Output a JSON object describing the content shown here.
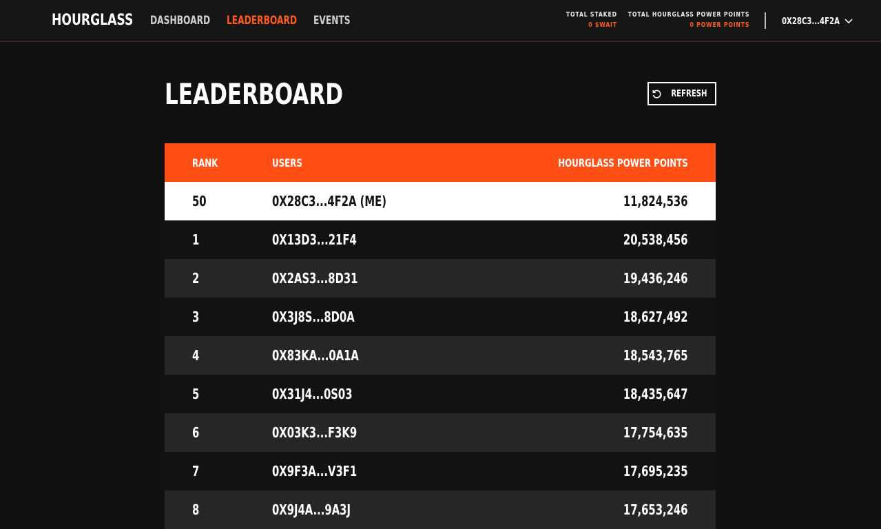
{
  "nav": {
    "brand": "HOURGLASS",
    "links": [
      {
        "label": "DASHBOARD",
        "active": false
      },
      {
        "label": "LEADERBOARD",
        "active": true
      },
      {
        "label": "EVENTS",
        "active": false
      }
    ],
    "stats": {
      "staked_label": "TOTAL STAKED",
      "staked_value": "0 $WAIT",
      "power_label": "TOTAL HOURGLASS POWER POINTS",
      "power_value": "0 POWER POINTS"
    },
    "wallet": "0X28C3...4F2A",
    "accent_color": "#ff5a1f"
  },
  "page": {
    "title": "LEADERBOARD",
    "refresh_label": "REFRESH"
  },
  "table": {
    "headers": {
      "rank": "RANK",
      "users": "USERS",
      "points": "HOURGLASS POWER POINTS"
    },
    "header_color": "#ff4f14",
    "me_row": {
      "rank": "50",
      "user": "0X28C3...4F2A (ME)",
      "points": "11,824,536"
    },
    "rows": [
      {
        "rank": "1",
        "user": "0X13D3...21F4",
        "points": "20,538,456"
      },
      {
        "rank": "2",
        "user": "0X2AS3...8D31",
        "points": "19,436,246"
      },
      {
        "rank": "3",
        "user": "0X3J8S...8D0A",
        "points": "18,627,492"
      },
      {
        "rank": "4",
        "user": "0X83KA...0A1A",
        "points": "18,543,765"
      },
      {
        "rank": "5",
        "user": "0X31J4...0S03",
        "points": "18,435,647"
      },
      {
        "rank": "6",
        "user": "0X03K3...F3K9",
        "points": "17,754,635"
      },
      {
        "rank": "7",
        "user": "0X9F3A...V3F1",
        "points": "17,695,235"
      },
      {
        "rank": "8",
        "user": "0X9J4A...9A3J",
        "points": "17,653,246"
      }
    ]
  }
}
